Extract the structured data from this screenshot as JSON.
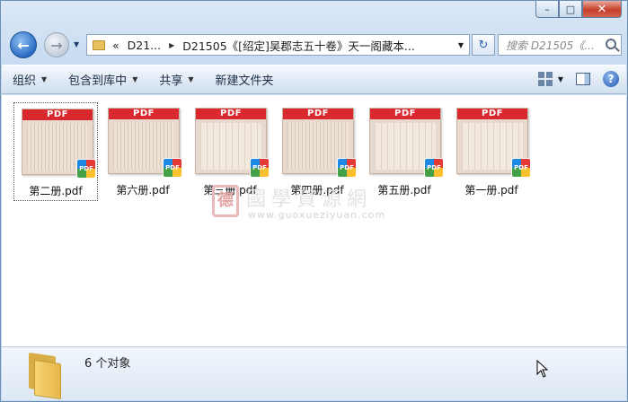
{
  "window": {
    "caption": {
      "minimize": "–",
      "maximize": "□",
      "close": "✕"
    }
  },
  "nav": {
    "back_icon": "arrow-left-icon",
    "forward_icon": "arrow-right-icon",
    "breadcrumb": [
      "«",
      "D21...",
      "D21505《[绍定]吴郡志五十卷》天一阁藏本..."
    ],
    "search_placeholder": "搜索 D21505《..."
  },
  "toolbar": {
    "organize": "组织",
    "include_in_library": "包含到库中",
    "share": "共享",
    "new_folder": "新建文件夹"
  },
  "files": [
    {
      "name": "第二册.pdf",
      "band": "PDF",
      "badge": "PDF",
      "selected": true
    },
    {
      "name": "第六册.pdf",
      "band": "PDF",
      "badge": "PDF",
      "selected": false
    },
    {
      "name": "第三册.pdf",
      "band": "PDF",
      "badge": "PDF",
      "selected": false
    },
    {
      "name": "第四册.pdf",
      "band": "PDF",
      "badge": "PDF",
      "selected": false
    },
    {
      "name": "第五册.pdf",
      "band": "PDF",
      "badge": "PDF",
      "selected": false
    },
    {
      "name": "第一册.pdf",
      "band": "PDF",
      "badge": "PDF",
      "selected": false
    }
  ],
  "watermark": {
    "seal": "德",
    "text": "國學資源網",
    "url": "www.guoxueziyuan.com"
  },
  "details": {
    "count_text": "6 个对象"
  },
  "colors": {
    "pdf_band": "#d9282e",
    "window_frame": "#c7dbf1"
  }
}
